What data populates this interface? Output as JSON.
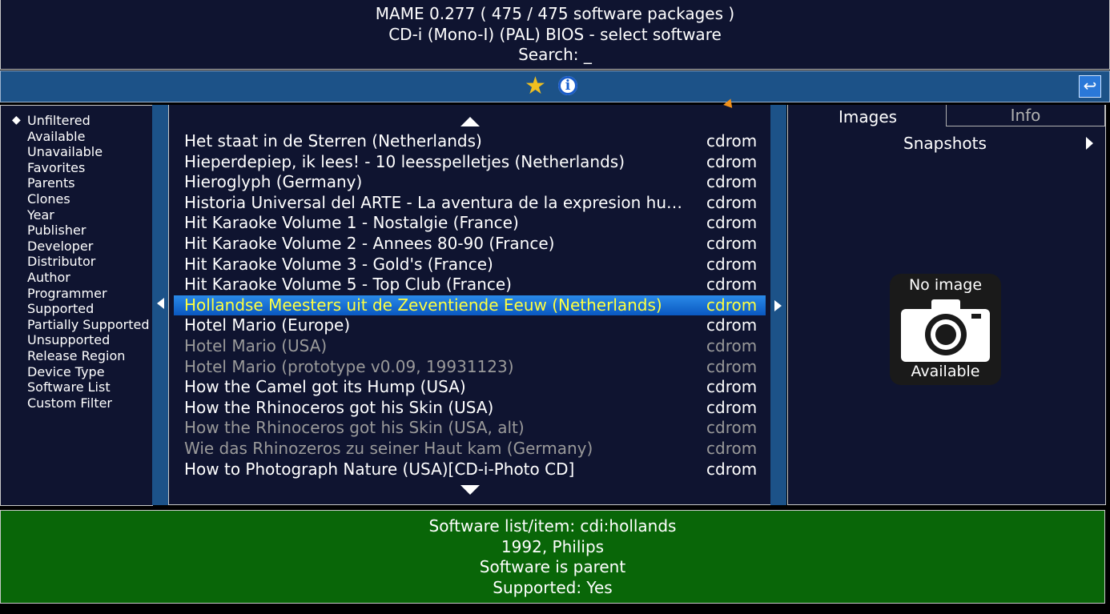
{
  "header": {
    "title": "MAME 0.277 ( 475 / 475 software packages )",
    "subtitle": "CD-i (Mono-I) (PAL) BIOS - select software",
    "search": "Search: _"
  },
  "toolbar": {
    "favorite_icon": "star-icon",
    "info_icon": "info-icon",
    "info_glyph": "i",
    "back_icon": "back-arrow-icon",
    "back_glyph": "↩"
  },
  "filters": {
    "selected_marker": "◆",
    "items": [
      "Unfiltered",
      "Available",
      "Unavailable",
      "Favorites",
      "Parents",
      "Clones",
      "Year",
      "Publisher",
      "Developer",
      "Distributor",
      "Author",
      "Programmer",
      "Supported",
      "Partially Supported",
      "Unsupported",
      "Release Region",
      "Device Type",
      "Software List",
      "Custom Filter"
    ]
  },
  "software_list": {
    "rows": [
      {
        "name": "Het staat in de Sterren (Netherlands)",
        "type": "cdrom"
      },
      {
        "name": "Hieperdepiep, ik lees! - 10 leesspelletjes (Netherlands)",
        "type": "cdrom"
      },
      {
        "name": "Hieroglyph (Germany)",
        "type": "cdrom"
      },
      {
        "name": "Historia Universal del ARTE - La aventura de la expresion hu…",
        "type": "cdrom"
      },
      {
        "name": "Hit Karaoke Volume 1 - Nostalgie (France)",
        "type": "cdrom"
      },
      {
        "name": "Hit Karaoke Volume 2 - Annees 80-90 (France)",
        "type": "cdrom"
      },
      {
        "name": "Hit Karaoke Volume 3 - Gold's (France)",
        "type": "cdrom"
      },
      {
        "name": "Hit Karaoke Volume 5 - Top Club (France)",
        "type": "cdrom"
      },
      {
        "name": "Hollandse Meesters uit de Zeventiende Eeuw (Netherlands)",
        "type": "cdrom"
      },
      {
        "name": "Hotel Mario (Europe)",
        "type": "cdrom"
      },
      {
        "name": "Hotel Mario (USA)",
        "type": "cdrom"
      },
      {
        "name": "Hotel Mario (prototype v0.09, 19931123)",
        "type": "cdrom"
      },
      {
        "name": "How the Camel got its Hump (USA)",
        "type": "cdrom"
      },
      {
        "name": "How the Rhinoceros got his Skin (USA)",
        "type": "cdrom"
      },
      {
        "name": "How the Rhinoceros got his Skin (USA, alt)",
        "type": "cdrom"
      },
      {
        "name": "Wie das Rhinozeros zu seiner Haut kam (Germany)",
        "type": "cdrom"
      },
      {
        "name": "How to Photograph Nature (USA)[CD-i-Photo CD]",
        "type": "cdrom"
      }
    ]
  },
  "right_panel": {
    "tab_images": "Images",
    "tab_info": "Info",
    "snapshots": "Snapshots",
    "no_image_top": "No image",
    "no_image_bottom": "Available"
  },
  "footer": {
    "line1": "Software list/item: cdi:hollands",
    "line2": "1992, Philips",
    "line3": "Software is parent",
    "line4": "Supported: Yes"
  },
  "colors": {
    "panel_bg": "#0f1430",
    "toolbar_bg": "#1c5288",
    "footer_bg": "#096608",
    "selected_text": "#ffff40",
    "dim_text": "#9a9a9a"
  }
}
